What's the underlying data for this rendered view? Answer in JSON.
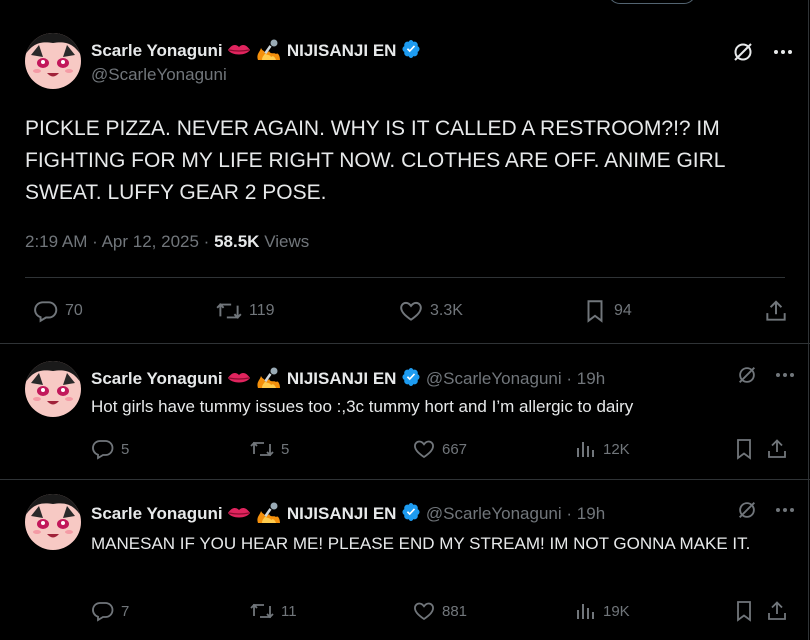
{
  "main": {
    "author_name": "Scarle Yonaguni",
    "org": "NIJISANJI EN",
    "handle": "@ScarleYonaguni",
    "text": "PICKLE PIZZA. NEVER AGAIN. WHY IS IT CALLED A RESTROOM?!? IM FIGHTING FOR MY LIFE RIGHT NOW. CLOTHES ARE OFF. ANIME GIRL SWEAT. LUFFY GEAR 2 POSE.",
    "time": "2:19 AM",
    "date": "Apr 12, 2025",
    "views": "58.5K",
    "views_label": "Views",
    "replies": "70",
    "reposts": "119",
    "likes": "3.3K",
    "bookmarks": "94"
  },
  "replies": [
    {
      "author_name": "Scarle Yonaguni",
      "org": "NIJISANJI EN",
      "handle": "@ScarleYonaguni",
      "age": "19h",
      "text": "Hot girls have tummy issues too :,3c tummy hort and I’m allergic to dairy",
      "replies": "5",
      "reposts": "5",
      "likes": "667",
      "views": "12K"
    },
    {
      "author_name": "Scarle Yonaguni",
      "org": "NIJISANJI EN",
      "handle": "@ScarleYonaguni",
      "age": "19h",
      "text": "MANESAN IF YOU HEAR ME! PLEASE END MY STREAM! IM NOT GONNA MAKE IT.",
      "replies": "7",
      "reposts": "11",
      "likes": "881",
      "views": "19K"
    }
  ],
  "icons": {
    "lips": "lips-emoji-icon",
    "microphone": "microphone-fire-emoji-icon",
    "verified": "verified-badge-icon",
    "grok": "grok-icon",
    "more": "more-icon",
    "reply": "reply-icon",
    "repost": "repost-icon",
    "like": "like-icon",
    "bookmark": "bookmark-icon",
    "share": "share-icon",
    "views": "views-icon"
  },
  "colors": {
    "background": "#000000",
    "text": "#e7e9ea",
    "muted": "#71767b",
    "divider": "#2f3336",
    "verified": "#1d9bf0"
  }
}
